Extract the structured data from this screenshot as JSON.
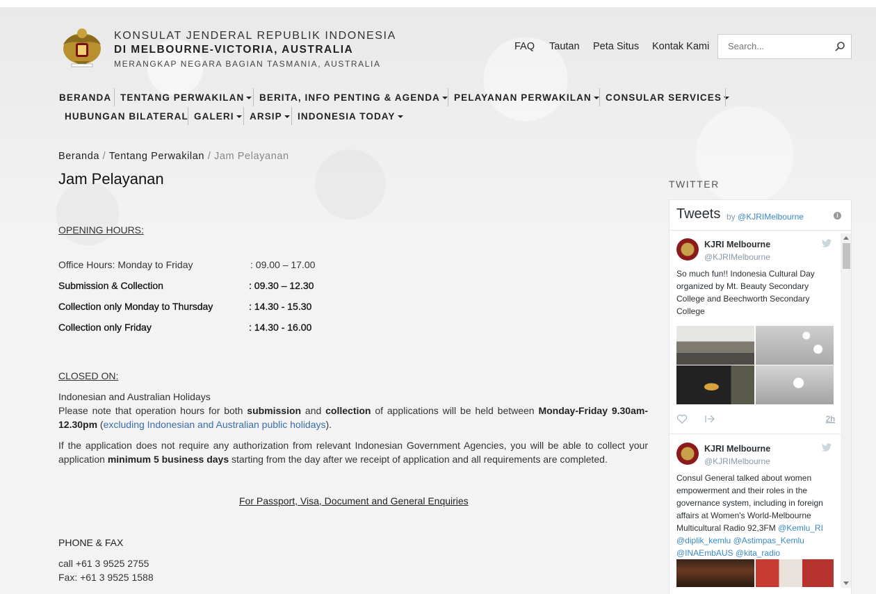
{
  "header": {
    "org_line1": "KONSULAT JENDERAL REPUBLIK INDONESIA",
    "org_line2": "DI MELBOURNE-VICTORIA, AUSTRALIA",
    "org_line3": "MERANGKAP NEGARA BAGIAN TASMANIA, AUSTRALIA",
    "top_links": [
      "FAQ",
      "Tautan",
      "Peta Situs",
      "Kontak Kami"
    ],
    "search_placeholder": "Search..."
  },
  "nav": {
    "items": [
      {
        "label": "BERANDA",
        "dropdown": false
      },
      {
        "label": "TENTANG PERWAKILAN",
        "dropdown": true
      },
      {
        "label": "BERITA, INFO PENTING & AGENDA",
        "dropdown": true
      },
      {
        "label": "PELAYANAN PERWAKILAN",
        "dropdown": true
      },
      {
        "label": "CONSULAR SERVICES",
        "dropdown": true
      },
      {
        "label": "HUBUNGAN BILATERAL",
        "dropdown": false
      },
      {
        "label": "GALERI",
        "dropdown": true
      },
      {
        "label": "ARSIP",
        "dropdown": true
      },
      {
        "label": "INDONESIA TODAY",
        "dropdown": true
      }
    ]
  },
  "breadcrumb": {
    "home": "Beranda",
    "parent": "Tentang Perwakilan",
    "current": "Jam Pelayanan",
    "separator": "/"
  },
  "page_title": "Jam Pelayanan",
  "content": {
    "opening_heading": "OPENING HOURS:",
    "hours": [
      {
        "label": "Office Hours: Monday to Friday",
        "value": ": 09.00 – 17.00",
        "bold": false
      },
      {
        "label": "Submission & Collection",
        "value": ": 09.30 – 12.30",
        "bold": true
      },
      {
        "label": "Collection only Monday to Thursday",
        "value": ": 14.30 - 15.30",
        "bold": true
      },
      {
        "label": "Collection only Friday",
        "value": ": 14.30 - 16.00",
        "bold": true
      }
    ],
    "closed_heading": "CLOSED ON:",
    "closed_line": "Indonesian and Australian Holidays",
    "note1": {
      "a": "Please note that operation hours for both ",
      "b": "submission",
      "c": " and ",
      "d": "collection",
      "e": " of applications will be held between ",
      "f": "Monday-Friday 9.30am-12.30pm",
      "g": " (",
      "h": "excluding Indonesian and Australian public holidays",
      "i": ")."
    },
    "note2": {
      "a": "If the application does not require any authorization from relevant Indonesian Government Agencies, you will be able to collect your application ",
      "b": "minimum 5 business days",
      "c": " starting from the day after we receipt of application and all requirements are completed."
    },
    "enquiries_heading": "For Passport, Visa, Document and General Enquiries",
    "phone_heading": "PHONE & FAX",
    "phone": "call +61 3 9525 2755",
    "fax": "Fax: +61 3 9525 1588"
  },
  "twitter": {
    "section_label": "TWITTER",
    "widget_title": "Tweets",
    "by": "by",
    "handle": "@KJRIMelbourne",
    "tweets": [
      {
        "name": "KJRI Melbourne",
        "handle": "@KJRIMelbourne",
        "text": "So much fun!! Indonesia Cultural Day organized by Mt. Beauty Secondary College and Beechworth Secondary College",
        "time": "2h"
      },
      {
        "name": "KJRI Melbourne",
        "handle": "@KJRIMelbourne",
        "text_plain": "Consul General talked about women empowerment and their roles in the governance system, including in foreign affairs at Women's World-Melbourne Multicultural Radio 92,3FM ",
        "mentions": [
          "@Kemlu_RI",
          "@diplik_kemlu",
          "@Astimpas_Kemlu",
          "@INAEmbAUS",
          "@kita_radio"
        ]
      }
    ]
  },
  "colors": {
    "link": "#3c6ea8",
    "twitter_link": "#3b88c3",
    "background": "#f1f1f1"
  }
}
